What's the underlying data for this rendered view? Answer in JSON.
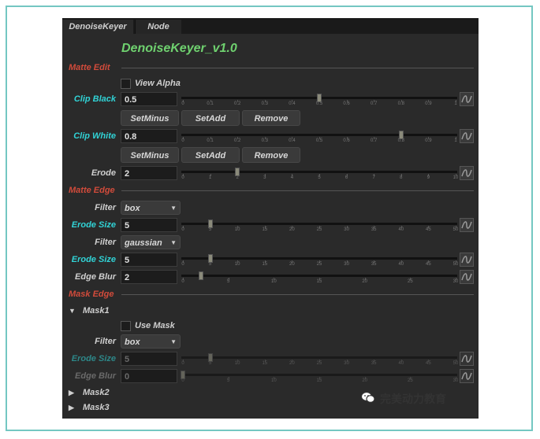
{
  "tabs": [
    "DenoiseKeyer",
    "Node"
  ],
  "title": "DenoiseKeyer_v1.0",
  "sections": {
    "matte_edit": "Matte Edit",
    "matte_edge": "Matte Edge",
    "mask_edge": "Mask Edge"
  },
  "view_alpha": {
    "label": "View Alpha",
    "checked": false
  },
  "clip_black": {
    "label": "Clip Black",
    "value": "0.5",
    "level": 0.5,
    "ticks": [
      "0",
      "0.1",
      "0.2",
      "0.3",
      "0.4",
      "0.5",
      "0.6",
      "0.7",
      "0.8",
      "0.9",
      "1"
    ],
    "buttons": [
      "SetMinus",
      "SetAdd",
      "Remove"
    ]
  },
  "clip_white": {
    "label": "Clip White",
    "value": "0.8",
    "level": 0.8,
    "ticks": [
      "0",
      "0.1",
      "0.2",
      "0.3",
      "0.4",
      "0.5",
      "0.6",
      "0.7",
      "0.8",
      "0.9",
      "1"
    ],
    "buttons": [
      "SetMinus",
      "SetAdd",
      "Remove"
    ]
  },
  "erode": {
    "label": "Erode",
    "value": "2",
    "level": 0.2,
    "ticks": [
      "0",
      "1",
      "2",
      "3",
      "4",
      "5",
      "6",
      "7",
      "8",
      "9",
      "10"
    ]
  },
  "matte_edge": {
    "filter1": {
      "label": "Filter",
      "value": "box"
    },
    "erode_size1": {
      "label": "Erode Size",
      "value": "5",
      "level": 0.1,
      "ticks": [
        "0",
        "5",
        "10",
        "15",
        "20",
        "25",
        "30",
        "35",
        "40",
        "45",
        "50"
      ]
    },
    "filter2": {
      "label": "Filter",
      "value": "gaussian"
    },
    "erode_size2": {
      "label": "Erode Size",
      "value": "5",
      "level": 0.1,
      "ticks": [
        "0",
        "5",
        "10",
        "15",
        "20",
        "25",
        "30",
        "35",
        "40",
        "45",
        "50"
      ]
    },
    "edge_blur": {
      "label": "Edge Blur",
      "value": "2",
      "level": 0.0667,
      "ticks": [
        "0",
        "5",
        "10",
        "15",
        "20",
        "25",
        "30"
      ]
    }
  },
  "mask1": {
    "label": "Mask1",
    "use_mask": {
      "label": "Use Mask",
      "checked": false
    },
    "filter": {
      "label": "Filter",
      "value": "box"
    },
    "erode_size": {
      "label": "Erode Size",
      "value": "5",
      "level": 0.1,
      "ticks": [
        "0",
        "5",
        "10",
        "15",
        "20",
        "25",
        "30",
        "35",
        "40",
        "45",
        "50"
      ]
    },
    "edge_blur": {
      "label": "Edge Blur",
      "value": "0",
      "level": 0.0,
      "ticks": [
        "0",
        "5",
        "10",
        "15",
        "20",
        "25",
        "30"
      ]
    }
  },
  "mask2": {
    "label": "Mask2"
  },
  "mask3": {
    "label": "Mask3"
  },
  "watermark": "完美动力教育",
  "colors": {
    "panel_bg": "#2a2a2a",
    "title": "#6fd16f",
    "section": "#d14b3b",
    "cyan_label": "#31d3d6",
    "frame": "#74c7c2"
  }
}
